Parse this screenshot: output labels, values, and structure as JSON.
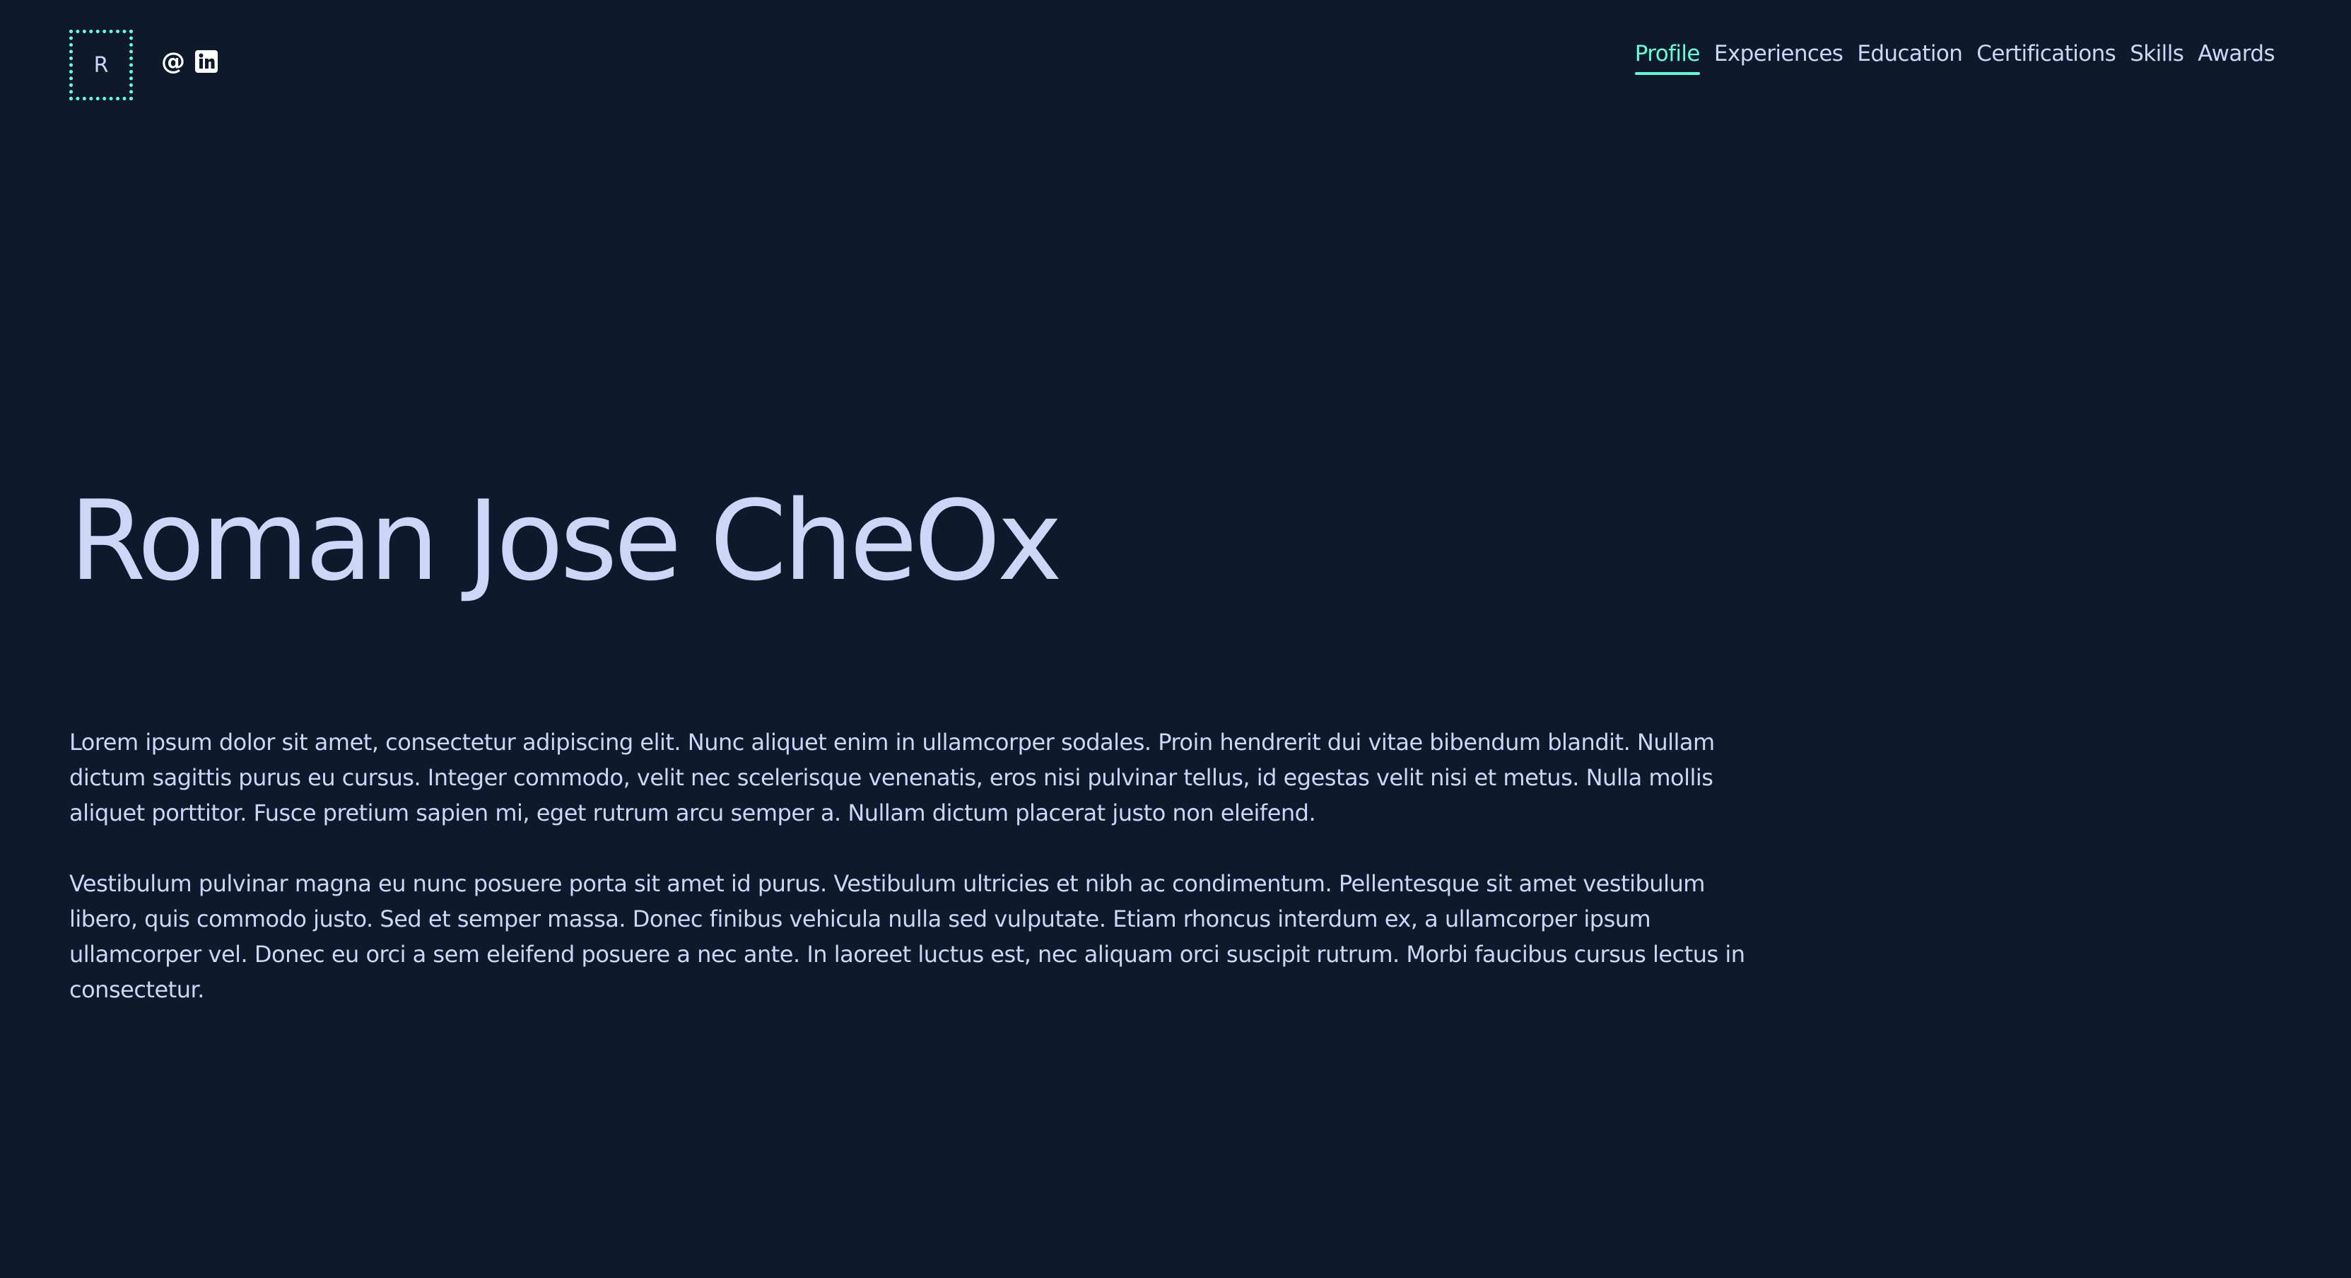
{
  "header": {
    "logo_letter": "R",
    "social": {
      "email_glyph": "@",
      "email_icon": "at-icon",
      "linkedin_icon": "linkedin-icon"
    },
    "nav": [
      {
        "label": "Profile",
        "active": true
      },
      {
        "label": "Experiences"
      },
      {
        "label": "Education"
      },
      {
        "label": "Certifications"
      },
      {
        "label": "Skills"
      },
      {
        "label": "Awards"
      }
    ]
  },
  "hero": {
    "name": "Roman Jose CheOx"
  },
  "bio": {
    "paragraphs": [
      "Lorem ipsum dolor sit amet, consectetur adipiscing elit. Nunc aliquet enim in ullamcorper sodales. Proin hendrerit dui vitae bibendum blandit. Nullam dictum sagittis purus eu cursus. Integer commodo, velit nec scelerisque venenatis, eros nisi pulvinar tellus, id egestas velit nisi et metus. Nulla mollis aliquet porttitor. Fusce pretium sapien mi, eget rutrum arcu semper a. Nullam dictum placerat justo non eleifend.",
      "Vestibulum pulvinar magna eu nunc posuere porta sit amet id purus. Vestibulum ultricies et nibh ac condimentum. Pellentesque sit amet vestibulum libero, quis commodo justo. Sed et semper massa. Donec finibus vehicula nulla sed vulputate. Etiam rhoncus interdum ex, a ullamcorper ipsum ullamcorper vel. Donec eu orci a sem eleifend posuere a nec ante. In laoreet luctus est, nec aliquam orci suscipit rutrum. Morbi faucibus cursus lectus in consectetur."
    ]
  },
  "colors": {
    "background": "#0e1a2c",
    "text": "#ccd6f6",
    "accent": "#64ffda"
  }
}
